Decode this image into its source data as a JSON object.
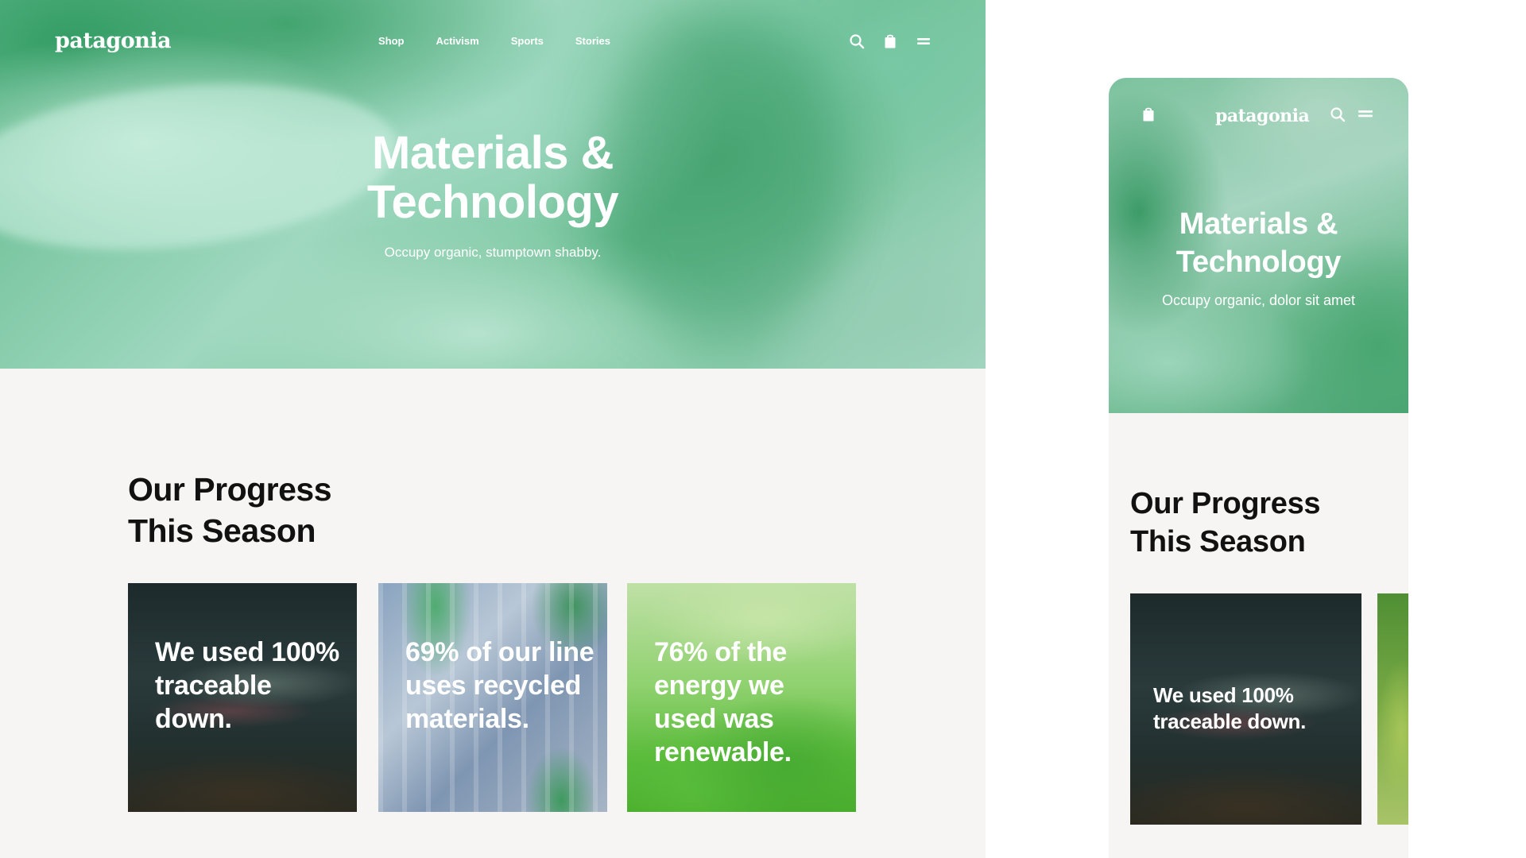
{
  "brand": "patagonia",
  "desktop": {
    "nav": [
      "Shop",
      "Activism",
      "Sports",
      "Stories"
    ],
    "hero": {
      "title_lines": [
        "Materials &",
        "Technology"
      ],
      "subtitle": "Occupy organic, stumptown shabby."
    },
    "progress": {
      "title_lines": [
        "Our Progress",
        "This Season"
      ],
      "cards": [
        {
          "text": "We used 100% traceable down.",
          "image": "fish"
        },
        {
          "text": "69% of our line uses recycled materials.",
          "image": "plastic-bottles"
        },
        {
          "text": "76% of the energy we used was renewable.",
          "image": "green-watercolor"
        }
      ]
    }
  },
  "mobile": {
    "hero": {
      "title_lines": [
        "Materials &",
        "Technology"
      ],
      "subtitle": "Occupy organic, dolor sit amet"
    },
    "progress": {
      "title_lines": [
        "Our Progress",
        "This Season"
      ],
      "cards": [
        {
          "text": "We used 100% traceable down.",
          "image": "fish"
        },
        {
          "text": "",
          "image": "green-partial"
        }
      ]
    }
  },
  "icons": {
    "search": "search-icon",
    "bag": "shopping-bag-icon",
    "menu": "menu-icon"
  },
  "colors": {
    "hero_green": "#7cc29e",
    "background": "#f6f5f3",
    "text_dark": "#111111",
    "text_light": "#ffffff"
  }
}
